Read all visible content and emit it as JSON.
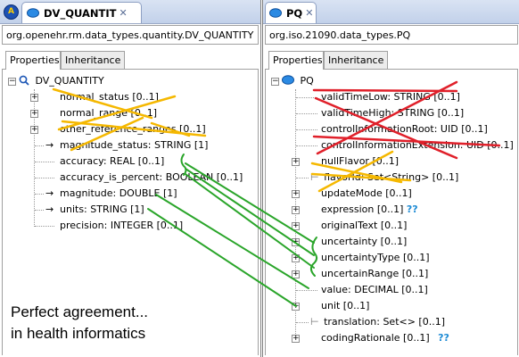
{
  "left": {
    "tab_title": "DV_QUANTIT",
    "class_path": "org.openehr.rm.data_types.quantity.DV_QUANTITY",
    "subtabs": [
      "Properties",
      "Inheritance"
    ],
    "root": "DV_QUANTITY",
    "items": [
      "normal_status [0..1]",
      "normal_range [0..1]",
      "other_reference_ranges [0..1]",
      "magnitude_status: STRING [1]",
      "accuracy: REAL [0..1]",
      "accuracy_is_percent: BOOLEAN [0..1]",
      "magnitude: DOUBLE [1]",
      "units: STRING [1]",
      "precision: INTEGER [0..1]"
    ]
  },
  "right": {
    "tab_title": "PQ",
    "class_path": "org.iso.21090.data_types.PQ",
    "subtabs": [
      "Properties",
      "Inheritance"
    ],
    "root": "PQ",
    "items": [
      "validTimeLow: STRING [0..1]",
      "validTimeHigh: STRING [0..1]",
      "controlInformationRoot: UID [0..1]",
      "controlInformationExtension: UID [0..1]",
      "nullFlavor [0..1]",
      "flavorId: Set<String> [0..1]",
      "updateMode [0..1]",
      "expression [0..1]",
      "originalText [0..1]",
      "uncertainty [0..1]",
      "uncertaintyType [0..1]",
      "uncertainRange [0..1]",
      "value: DECIMAL [0..1]",
      "unit [0..1]",
      "translation: Set<> [0..1]",
      "codingRationale [0..1]"
    ],
    "question_marks": "??"
  },
  "caption_lines": [
    "Perfect agreement...",
    "in health informatics"
  ],
  "colors": {
    "strike_orange": "#f5b800",
    "strike_red": "#e0202a",
    "link_green": "#2aa52a",
    "question_blue": "#1e8bd4"
  }
}
